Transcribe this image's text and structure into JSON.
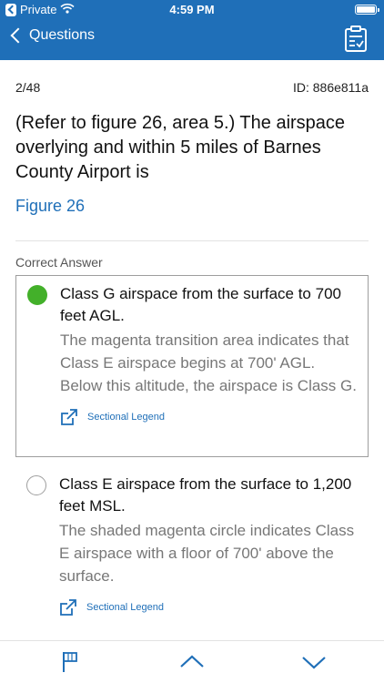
{
  "status_bar": {
    "carrier": "Private",
    "time": "4:59 PM"
  },
  "nav": {
    "back_label": "Questions",
    "right_icon": "checklist-icon"
  },
  "question": {
    "counter": "2/48",
    "id": "ID: 886e811a",
    "text": "(Refer to figure 26, area 5.) The airspace overlying and within 5 miles of Barnes County Airport is",
    "figure_link": "Figure 26"
  },
  "correct_answer_label": "Correct Answer",
  "answers": [
    {
      "title": "Class G airspace from the surface to 700 feet AGL.",
      "explanation": "The magenta transition area indicates that Class E airspace begins at 700' AGL.  Below this altitude, the airspace is Class G.",
      "link": "Sectional Legend",
      "selected": true
    },
    {
      "title": "Class E airspace from the surface to 1,200 feet MSL.",
      "explanation": "The shaded magenta circle indicates Class E airspace with a floor of 700' above the surface.",
      "link": "Sectional Legend",
      "selected": false
    }
  ],
  "tabbar": {
    "items": [
      "flag-icon",
      "chevron-up-icon",
      "chevron-down-icon"
    ]
  },
  "colors": {
    "brand_blue": "#1f6fb8",
    "correct_green": "#43b02a"
  }
}
